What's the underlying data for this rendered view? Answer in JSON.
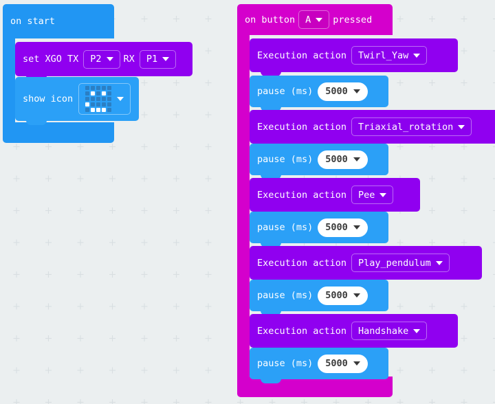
{
  "app": {
    "editor": "MakeCode Blocks Workspace",
    "background_color": "#ebeff0",
    "grid_mark": "plus"
  },
  "palette": {
    "event_blue": "#2196f3",
    "event_magenta": "#d400cc",
    "xgo_purple": "#9000f0",
    "basic_blue": "#2ba0f7",
    "field_white": "#ffffff",
    "text_white": "#ffffff",
    "text_dark": "#3a3a3a"
  },
  "scripts": [
    {
      "id": "on-start-script",
      "hat": {
        "label": "on start",
        "color": "#2196f3"
      },
      "body": [
        {
          "kind": "set-xgo-serial",
          "color": "#9000f0",
          "parts": [
            {
              "type": "label",
              "text": "set XGO TX"
            },
            {
              "type": "dropdown",
              "value": "P2"
            },
            {
              "type": "label",
              "text": "RX"
            },
            {
              "type": "dropdown",
              "value": "P1"
            }
          ]
        },
        {
          "kind": "show-icon",
          "color": "#2ba0f7",
          "parts": [
            {
              "type": "label",
              "text": "show icon"
            },
            {
              "type": "icon-dropdown",
              "value": "IconNames.Happy",
              "matrix": [
                [
                  0,
                  0,
                  0,
                  0,
                  0
                ],
                [
                  0,
                  1,
                  0,
                  1,
                  0
                ],
                [
                  0,
                  0,
                  0,
                  0,
                  0
                ],
                [
                  1,
                  0,
                  0,
                  0,
                  0
                ],
                [
                  0,
                  1,
                  1,
                  1,
                  0
                ]
              ]
            }
          ]
        }
      ]
    },
    {
      "id": "on-button-pressed-script",
      "hat": {
        "label_before": "on button",
        "button": "A",
        "label_after": "pressed",
        "color": "#d400cc"
      },
      "body": [
        {
          "kind": "execution-action",
          "color": "#9000f0",
          "label": "Execution action",
          "value": "Twirl_Yaw"
        },
        {
          "kind": "pause",
          "color": "#2ba0f7",
          "label": "pause (ms)",
          "value": "5000"
        },
        {
          "kind": "execution-action",
          "color": "#9000f0",
          "label": "Execution action",
          "value": "Triaxial_rotation"
        },
        {
          "kind": "pause",
          "color": "#2ba0f7",
          "label": "pause (ms)",
          "value": "5000"
        },
        {
          "kind": "execution-action",
          "color": "#9000f0",
          "label": "Execution action",
          "value": "Pee"
        },
        {
          "kind": "pause",
          "color": "#2ba0f7",
          "label": "pause (ms)",
          "value": "5000"
        },
        {
          "kind": "execution-action",
          "color": "#9000f0",
          "label": "Execution action",
          "value": "Play_pendulum"
        },
        {
          "kind": "pause",
          "color": "#2ba0f7",
          "label": "pause (ms)",
          "value": "5000"
        },
        {
          "kind": "execution-action",
          "color": "#9000f0",
          "label": "Execution action",
          "value": "Handshake"
        },
        {
          "kind": "pause",
          "color": "#2ba0f7",
          "label": "pause (ms)",
          "value": "5000"
        }
      ]
    }
  ]
}
